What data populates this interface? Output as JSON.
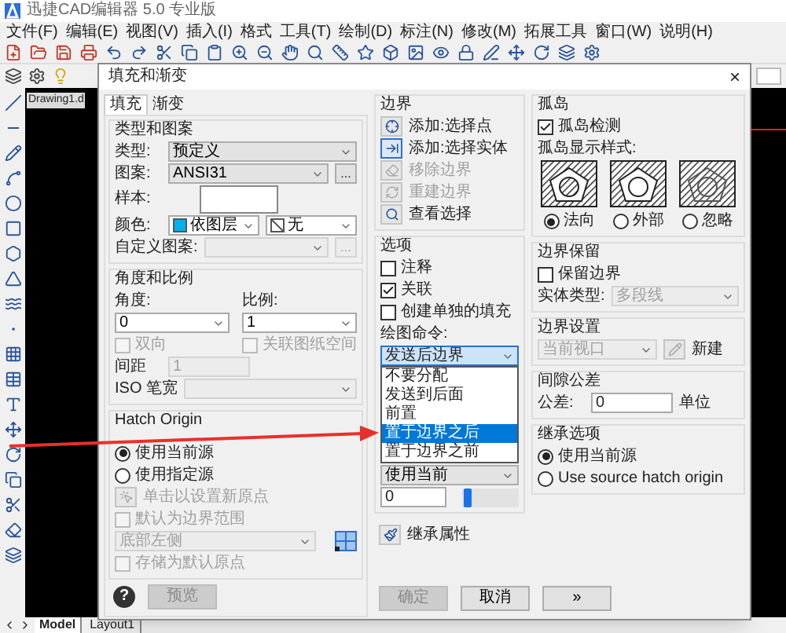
{
  "app": {
    "title": "迅捷CAD编辑器 5.0 专业版",
    "menu": [
      "文件(F)",
      "编辑(E)",
      "视图(V)",
      "插入(I)",
      "格式",
      "工具(T)",
      "绘制(D)",
      "标注(N)",
      "修改(M)",
      "拓展工具",
      "窗口(W)",
      "说明(H)"
    ],
    "document_tab": "Drawing1.d",
    "layout_tabs": [
      {
        "label": "Model",
        "selected": true
      },
      {
        "label": "Layout1",
        "selected": false
      }
    ]
  },
  "dialog": {
    "title": "填充和渐变",
    "close": "×",
    "tabs": [
      {
        "label": "填充",
        "selected": true
      },
      {
        "label": "渐变",
        "selected": false
      }
    ],
    "columns": [
      {
        "groups": [
          {
            "title": "类型和图案",
            "rows": [
              {
                "kind": "line",
                "items": [
                  {
                    "kind": "label",
                    "text": "类型:"
                  },
                  {
                    "kind": "select",
                    "value": "预定义",
                    "disabled": false
                  }
                ]
              },
              {
                "kind": "line",
                "items": [
                  {
                    "kind": "label",
                    "text": "图案:"
                  },
                  {
                    "kind": "select",
                    "value": "ANSI31",
                    "disabled": false
                  },
                  {
                    "kind": "more",
                    "text": "...",
                    "disabled": false
                  }
                ]
              },
              {
                "kind": "line",
                "items": [
                  {
                    "kind": "label",
                    "text": "样本:"
                  },
                  {
                    "kind": "sample"
                  }
                ]
              },
              {
                "kind": "line",
                "items": [
                  {
                    "kind": "label",
                    "text": "颜色:"
                  },
                  {
                    "kind": "color-combo",
                    "value": "依图层",
                    "color": "#00b0f0"
                  },
                  {
                    "kind": "no-fill-combo",
                    "value": "无"
                  }
                ]
              },
              {
                "kind": "line",
                "items": [
                  {
                    "kind": "label",
                    "text": "自定义图案:"
                  },
                  {
                    "kind": "select",
                    "disabled": true
                  },
                  {
                    "kind": "more",
                    "text": "...",
                    "disabled": true
                  }
                ]
              }
            ]
          },
          {
            "title": "角度和比例",
            "rows": [
              {
                "kind": "pair",
                "items": [
                  {
                    "kind": "label",
                    "text": "角度:"
                  },
                  {
                    "kind": "label",
                    "text": "比例:"
                  }
                ]
              },
              {
                "kind": "pair",
                "items": [
                  {
                    "kind": "combo",
                    "value": "0"
                  },
                  {
                    "kind": "combo",
                    "value": "1"
                  }
                ]
              },
              {
                "kind": "pair",
                "items": [
                  {
                    "kind": "checkbox",
                    "label": "双向",
                    "checked": false,
                    "disabled": true
                  },
                  {
                    "kind": "checkbox",
                    "label": "关联图纸空间",
                    "checked": false,
                    "disabled": true
                  }
                ]
              },
              {
                "kind": "line",
                "items": [
                  {
                    "kind": "label",
                    "text": "间距"
                  },
                  {
                    "kind": "input",
                    "value": "1",
                    "disabled": true
                  }
                ]
              },
              {
                "kind": "line",
                "items": [
                  {
                    "kind": "label",
                    "text": "ISO 笔宽"
                  },
                  {
                    "kind": "select",
                    "disabled": true
                  }
                ]
              }
            ]
          },
          {
            "title": "Hatch Origin",
            "rows": [
              {
                "kind": "line",
                "items": [
                  {
                    "kind": "radio",
                    "label": "使用当前源",
                    "selected": true
                  }
                ]
              },
              {
                "kind": "line",
                "items": [
                  {
                    "kind": "radio",
                    "label": "使用指定源",
                    "selected": false
                  }
                ]
              },
              {
                "kind": "line",
                "items": [
                  {
                    "kind": "origin",
                    "label": "单击以设置新原点",
                    "disabled": true
                  }
                ]
              },
              {
                "kind": "line",
                "items": [
                  {
                    "kind": "checkbox",
                    "label": "默认为边界范围",
                    "checked": false,
                    "disabled": true
                  }
                ]
              },
              {
                "kind": "line",
                "items": [
                  {
                    "kind": "select",
                    "value": "底部左侧",
                    "disabled": true
                  },
                  {
                    "kind": "position-icon"
                  }
                ]
              },
              {
                "kind": "line",
                "items": [
                  {
                    "kind": "checkbox",
                    "label": "存储为默认原点",
                    "checked": false,
                    "disabled": true
                  }
                ]
              }
            ]
          }
        ],
        "footer": [
          {
            "kind": "help",
            "text": "?"
          },
          {
            "kind": "button",
            "text": "预览",
            "disabled": true
          }
        ]
      },
      {
        "groups": [
          {
            "title": "边界",
            "rows": [
              {
                "kind": "line",
                "items": [
                  {
                    "kind": "pick-point",
                    "label": "添加:选择点",
                    "disabled": false
                  }
                ]
              },
              {
                "kind": "line",
                "items": [
                  {
                    "kind": "select-object",
                    "label": "添加:选择实体",
                    "disabled": false
                  }
                ]
              },
              {
                "kind": "line",
                "items": [
                  {
                    "kind": "remove",
                    "label": "移除边界",
                    "disabled": true
                  }
                ]
              },
              {
                "kind": "line",
                "items": [
                  {
                    "kind": "rebuild",
                    "label": "重建边界",
                    "disabled": true
                  }
                ]
              },
              {
                "kind": "line",
                "items": [
                  {
                    "kind": "view",
                    "label": "查看选择",
                    "disabled": false
                  }
                ]
              }
            ]
          },
          {
            "title": "选项",
            "rows": [
              {
                "kind": "line",
                "items": [
                  {
                    "kind": "checkbox",
                    "label": "注释",
                    "checked": false,
                    "disabled": false
                  }
                ]
              },
              {
                "kind": "line",
                "items": [
                  {
                    "kind": "checkbox",
                    "label": "关联",
                    "checked": true,
                    "disabled": false
                  }
                ]
              },
              {
                "kind": "line",
                "items": [
                  {
                    "kind": "checkbox",
                    "label": "创建单独的填充",
                    "checked": false,
                    "disabled": false
                  }
                ]
              },
              {
                "kind": "line",
                "items": [
                  {
                    "kind": "label",
                    "text": "绘图命令:"
                  }
                ]
              },
              {
                "kind": "line",
                "items": [
                  {
                    "kind": "dropdown",
                    "value": "发送后边界",
                    "expanded": true,
                    "options": [
                      {
                        "label": "不要分配",
                        "selected": false
                      },
                      {
                        "label": "发送到后面",
                        "selected": false
                      },
                      {
                        "label": "前置",
                        "selected": false
                      },
                      {
                        "label": "置于边界之后",
                        "selected": true
                      },
                      {
                        "label": "置于边界之前",
                        "selected": false
                      }
                    ]
                  }
                ]
              },
              {
                "kind": "line",
                "items": [
                  {
                    "kind": "select",
                    "value": "使用当前",
                    "disabled": false
                  }
                ]
              },
              {
                "kind": "line",
                "items": [
                  {
                    "kind": "input",
                    "value": "0",
                    "disabled": false
                  },
                  {
                    "kind": "slider",
                    "level": 0.02
                  }
                ]
              }
            ]
          },
          {
            "rows": [
              {
                "kind": "line",
                "items": [
                  {
                    "kind": "inherit",
                    "label": "继承属性",
                    "disabled": false
                  }
                ]
              }
            ]
          }
        ],
        "footer": [
          {
            "kind": "button",
            "text": "确定",
            "disabled": true
          },
          {
            "kind": "button",
            "text": "取消",
            "disabled": false
          },
          {
            "kind": "button",
            "text": "»",
            "disabled": false
          }
        ]
      },
      {
        "groups": [
          {
            "title": "孤岛",
            "rows": [
              {
                "kind": "line",
                "items": [
                  {
                    "kind": "checkbox",
                    "label": "孤岛检测",
                    "checked": true,
                    "disabled": false
                  }
                ]
              },
              {
                "kind": "line",
                "items": [
                  {
                    "kind": "label",
                    "text": "孤岛显示样式:"
                  }
                ]
              },
              {
                "kind": "line",
                "items": [
                  {
                    "kind": "island-styles",
                    "options": [
                      {
                        "kind": "normal",
                        "label": "法向",
                        "selected": true
                      },
                      {
                        "kind": "outer",
                        "label": "外部",
                        "selected": false
                      },
                      {
                        "kind": "ignore",
                        "label": "忽略",
                        "selected": false
                      }
                    ]
                  }
                ]
              }
            ]
          },
          {
            "title": "边界保留",
            "rows": [
              {
                "kind": "line",
                "items": [
                  {
                    "kind": "checkbox",
                    "label": "保留边界",
                    "checked": false,
                    "disabled": false
                  }
                ]
              },
              {
                "kind": "line",
                "items": [
                  {
                    "kind": "label",
                    "text": "实体类型:"
                  },
                  {
                    "kind": "select",
                    "value": "多段线",
                    "disabled": true
                  }
                ]
              }
            ]
          },
          {
            "title": "边界设置",
            "rows": [
              {
                "kind": "line",
                "items": [
                  {
                    "kind": "select",
                    "value": "当前视口",
                    "disabled": true
                  },
                  {
                    "kind": "new-boundary",
                    "disabled": true
                  },
                  {
                    "kind": "label",
                    "text": "新建"
                  }
                ]
              }
            ]
          },
          {
            "title": "间隙公差",
            "rows": [
              {
                "kind": "line",
                "items": [
                  {
                    "kind": "label",
                    "text": "公差:"
                  },
                  {
                    "kind": "input",
                    "value": "0",
                    "disabled": false
                  },
                  {
                    "kind": "label",
                    "text": "单位"
                  }
                ]
              }
            ]
          },
          {
            "title": "继承选项",
            "rows": [
              {
                "kind": "line",
                "items": [
                  {
                    "kind": "radio",
                    "label": "使用当前源",
                    "selected": true
                  }
                ]
              },
              {
                "kind": "line",
                "items": [
                  {
                    "kind": "radio",
                    "label": "Use source hatch origin",
                    "selected": false
                  }
                ]
              }
            ]
          }
        ]
      }
    ]
  }
}
